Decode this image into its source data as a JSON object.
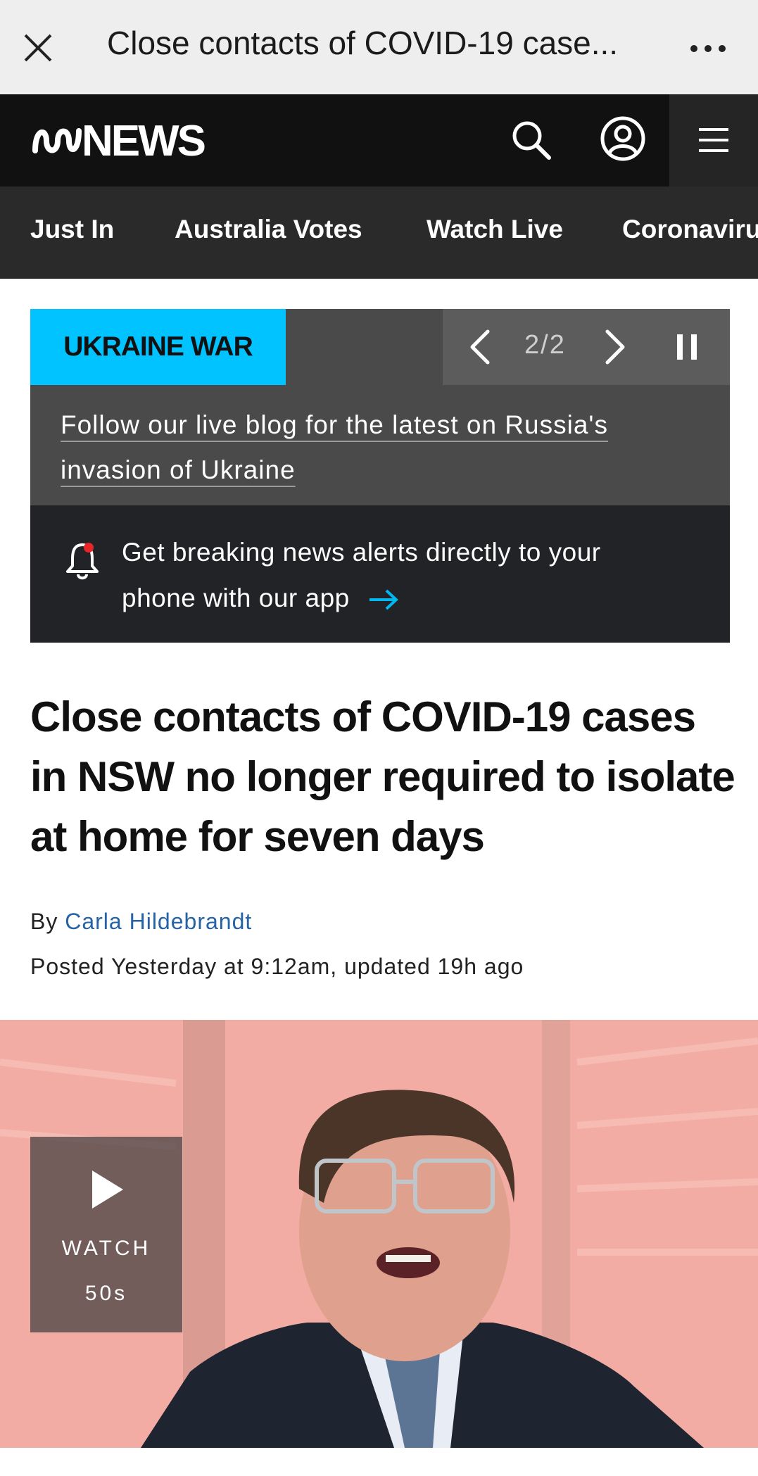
{
  "browser": {
    "title": "Close contacts of COVID-19 case..."
  },
  "header": {
    "logo_text": "NEWS"
  },
  "nav": {
    "items": [
      "Just In",
      "Australia Votes",
      "Watch Live",
      "Coronavirus"
    ]
  },
  "banner": {
    "tag": "UKRAINE WAR",
    "pager": "2/2",
    "blog_line1": "Follow our live blog for the latest on Russia's",
    "blog_line2": "invasion of Ukraine",
    "app_line1": "Get breaking news alerts directly to your",
    "app_line2": "phone with our app"
  },
  "article": {
    "headline": "Close contacts of COVID-19 cases in NSW no longer required to isolate at home for seven days",
    "by_prefix": "By",
    "author": "Carla Hildebrandt",
    "posted": "Posted Yesterday at 9:12am, updated 19h ago"
  },
  "video": {
    "watch_label": "WATCH",
    "duration": "50s"
  },
  "colors": {
    "accent_cyan": "#00c3ff",
    "link_blue": "#2563a6",
    "header_bg": "#111111"
  }
}
